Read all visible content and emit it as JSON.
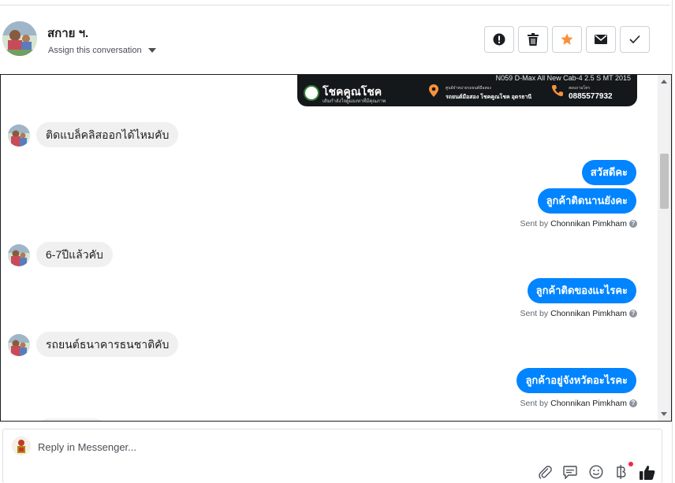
{
  "header": {
    "contact_name": "สกาย ฯ.",
    "assign_label": "Assign this conversation",
    "actions": [
      {
        "name": "report-button",
        "icon": "exclamation-icon"
      },
      {
        "name": "delete-button",
        "icon": "trash-icon"
      },
      {
        "name": "star-button",
        "icon": "star-icon",
        "color": "#f7923b"
      },
      {
        "name": "mark-unread-button",
        "icon": "envelope-icon"
      },
      {
        "name": "mark-done-button",
        "icon": "check-icon"
      }
    ]
  },
  "banner": {
    "model_text": "N059  D-Max All New Cab-4 2.5 S MT 2015",
    "brand": "โชคคูณโชค",
    "tagline": "เติมกำลังใจผู้มองหาที่มีคุณภาพ",
    "location_label": "ศูนย์จำหน่ายรถยนต์มือสอง",
    "location": "รถยนต์มือสอง โชคคูณโชค อุดรธานี",
    "phone_label": "สอบถามโทร",
    "phone": "0885577932"
  },
  "messages": [
    {
      "direction": "in",
      "text": "ติดแบล็คลิสออกได้ไหมคับ"
    },
    {
      "direction": "out",
      "text": "สวัสดีคะ"
    },
    {
      "direction": "out",
      "text": "ลูกค้าติดนานยังคะ"
    },
    {
      "direction": "in",
      "text": "6-7ปีแล้วคับ"
    },
    {
      "direction": "out",
      "text": "ลูกค้าติดของแะไรคะ"
    },
    {
      "direction": "in",
      "text": "รถยนต์ธนาคารธนชาติคับ"
    },
    {
      "direction": "out",
      "text": "ลูกค้าอยู่จังหวัดอะไรคะ"
    }
  ],
  "sent_by": {
    "prefix": "Sent by",
    "agent": "Chonnikan Pimkham"
  },
  "composer": {
    "placeholder": "Reply in Messenger...",
    "tools": [
      "paperclip-icon",
      "chat-bubble-icon",
      "smiley-icon",
      "baht-icon",
      "thumbs-up-icon"
    ]
  },
  "colors": {
    "outgoing_bubble": "#0084ff",
    "incoming_bubble": "#f0f0f0",
    "star": "#f7923b",
    "notification_dot": "#f02849"
  }
}
